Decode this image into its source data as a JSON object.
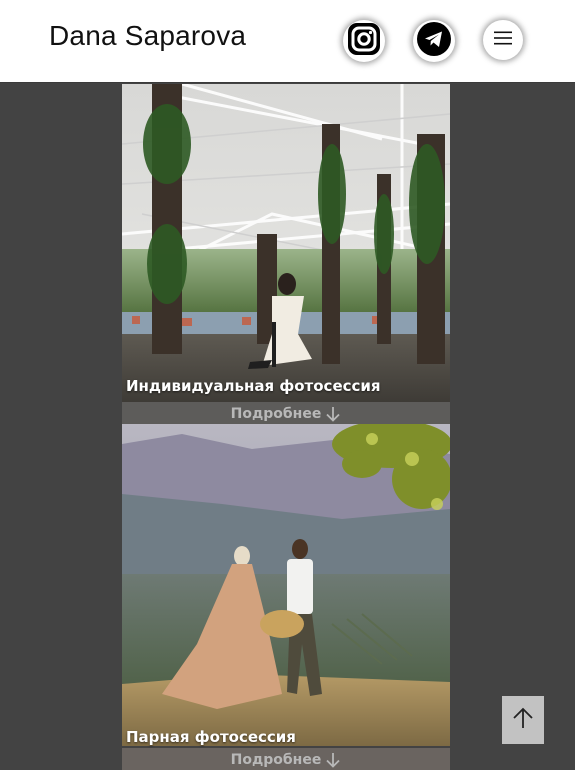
{
  "header": {
    "title": "Dana Saparova",
    "icons": [
      "instagram-icon",
      "telegram-icon",
      "menu-icon"
    ]
  },
  "cards": [
    {
      "caption": "Индивидуальная фотосессия",
      "more": "Подробнее"
    },
    {
      "caption": "Парная фотосессия",
      "more": "Подробнее"
    }
  ],
  "scroll_top": {
    "icon": "arrow-up-icon"
  },
  "colors": {
    "page_bg": "#434343",
    "header_bg": "#ffffff",
    "to_top_bg": "#c2c2c2"
  }
}
